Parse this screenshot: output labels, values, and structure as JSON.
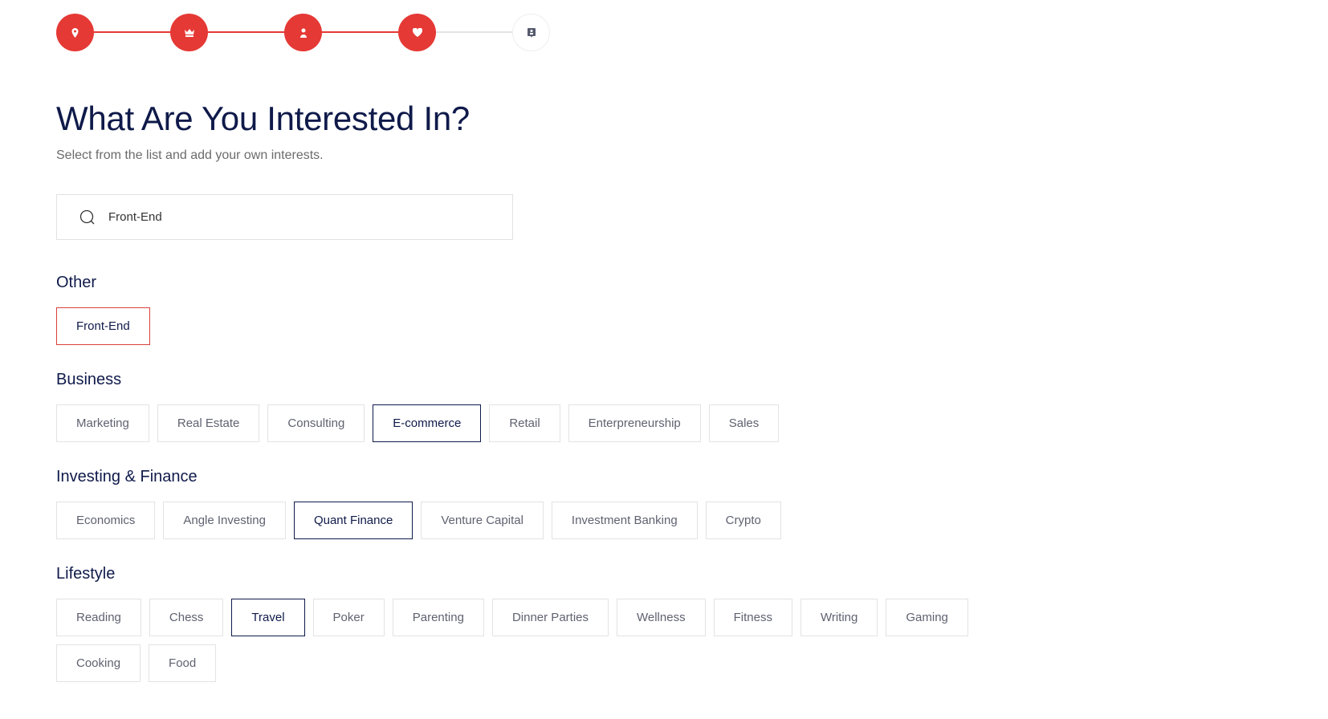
{
  "colors": {
    "accent": "#e53935",
    "navy": "#0f1a4a",
    "incomplete": "#e2e2e2"
  },
  "stepper": {
    "steps": [
      {
        "icon": "location-pin-icon",
        "status": "complete"
      },
      {
        "icon": "crown-icon",
        "status": "complete"
      },
      {
        "icon": "person-icon",
        "status": "complete"
      },
      {
        "icon": "heart-icon",
        "status": "complete"
      },
      {
        "icon": "id-badge-icon",
        "status": "incomplete"
      }
    ]
  },
  "header": {
    "title": "What Are You Interested In?",
    "subtitle": "Select from the list and add your own interests."
  },
  "search": {
    "value": "Front-End",
    "icon": "search-icon"
  },
  "sections": [
    {
      "title": "Other",
      "items": [
        {
          "label": "Front-End",
          "state": "added"
        }
      ]
    },
    {
      "title": "Business",
      "items": [
        {
          "label": "Marketing"
        },
        {
          "label": "Real Estate"
        },
        {
          "label": "Consulting"
        },
        {
          "label": "E-commerce",
          "state": "selected"
        },
        {
          "label": "Retail"
        },
        {
          "label": "Enterpreneurship"
        },
        {
          "label": "Sales"
        }
      ]
    },
    {
      "title": "Investing & Finance",
      "items": [
        {
          "label": "Economics"
        },
        {
          "label": "Angle Investing"
        },
        {
          "label": "Quant Finance",
          "state": "selected"
        },
        {
          "label": "Venture Capital"
        },
        {
          "label": "Investment Banking"
        },
        {
          "label": "Crypto"
        }
      ]
    },
    {
      "title": "Lifestyle",
      "items": [
        {
          "label": "Reading"
        },
        {
          "label": "Chess"
        },
        {
          "label": "Travel",
          "state": "selected"
        },
        {
          "label": "Poker"
        },
        {
          "label": "Parenting"
        },
        {
          "label": "Dinner Parties"
        },
        {
          "label": "Wellness"
        },
        {
          "label": "Fitness"
        },
        {
          "label": "Writing"
        },
        {
          "label": "Gaming"
        },
        {
          "label": "Cooking"
        },
        {
          "label": "Food"
        }
      ]
    }
  ]
}
